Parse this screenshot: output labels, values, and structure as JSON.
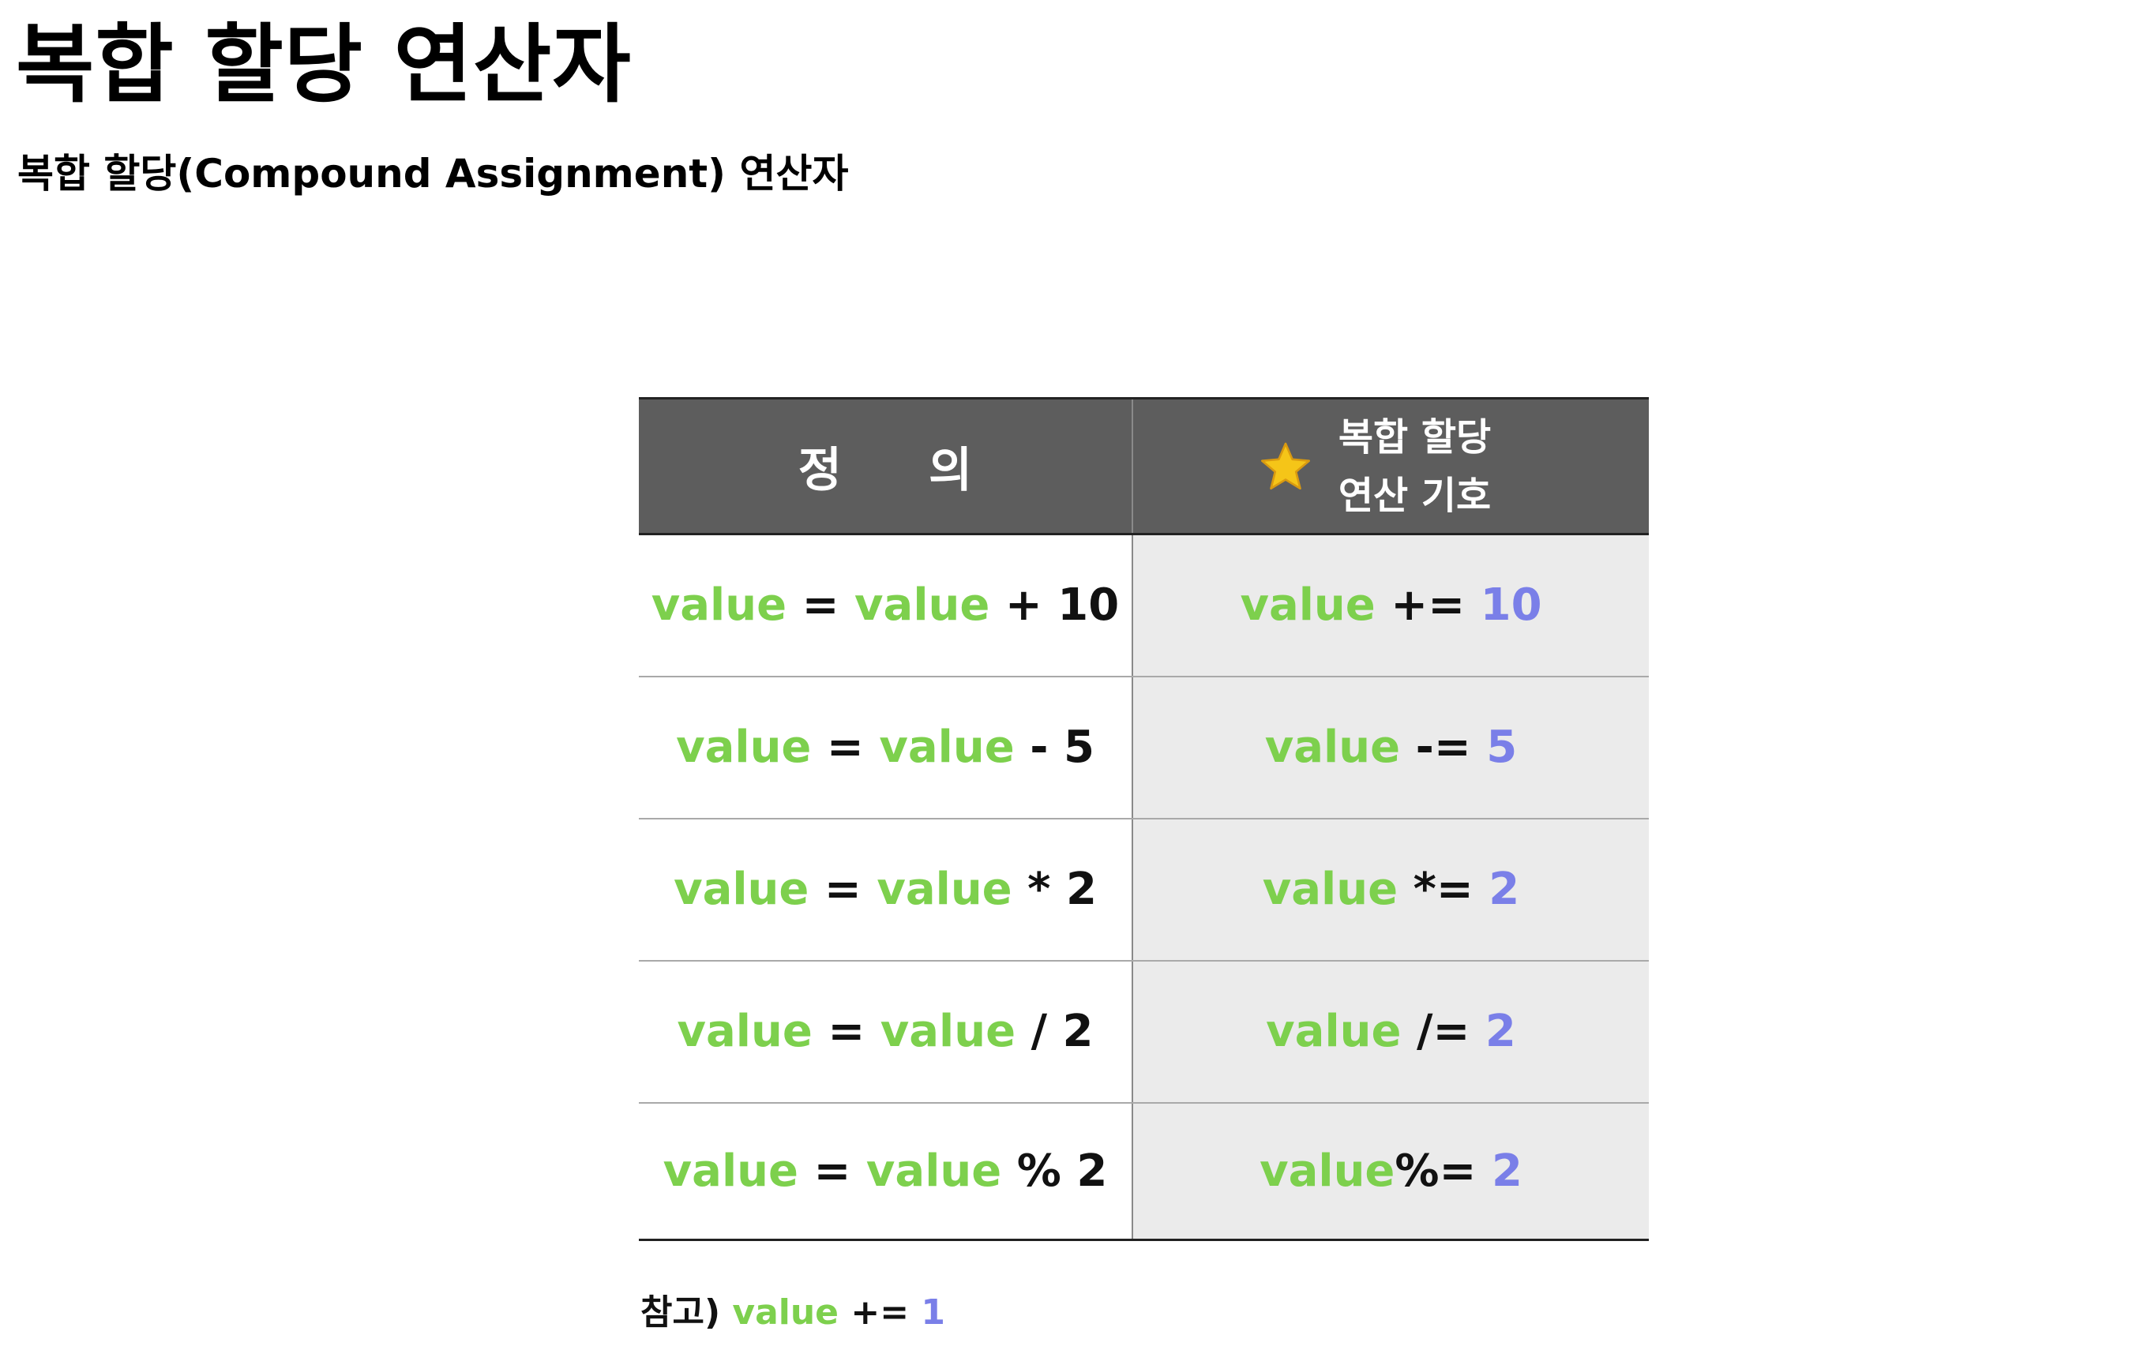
{
  "page": {
    "title": "복합 할당 연산자",
    "subtitle": "복합 할당(Compound Assignment) 연산자"
  },
  "table": {
    "header": {
      "definition_chars": [
        "정",
        "의"
      ],
      "symbol_icon": "star-icon",
      "symbol_lines": [
        "복합 할당",
        "연산 기호"
      ]
    },
    "rows": [
      {
        "def": {
          "var1": "value",
          "eq": "=",
          "var2": "value",
          "op": "+",
          "num": "10"
        },
        "cmp": {
          "var": "value",
          "op": "+=",
          "num": "10"
        }
      },
      {
        "def": {
          "var1": "value",
          "eq": "=",
          "var2": "value",
          "op": "-",
          "num": "5"
        },
        "cmp": {
          "var": "value",
          "op": "-=",
          "num": "5"
        }
      },
      {
        "def": {
          "var1": "value",
          "eq": "=",
          "var2": "value",
          "op": "*",
          "num": "2"
        },
        "cmp": {
          "var": "value",
          "op": "*=",
          "num": "2"
        }
      },
      {
        "def": {
          "var1": "value",
          "eq": "=",
          "var2": "value",
          "op": "/",
          "num": "2"
        },
        "cmp": {
          "var": "value",
          "op": "/=",
          "num": "2"
        }
      },
      {
        "def": {
          "var1": "value",
          "eq": "=",
          "var2": "value",
          "op": "%",
          "num": "2"
        },
        "cmp": {
          "var": "value",
          "op": "%=",
          "num": "2"
        }
      }
    ]
  },
  "note": {
    "label": "참고)",
    "var": "value",
    "op": "+=",
    "num": "1"
  },
  "colors": {
    "header_bg": "#5d5d5d",
    "header_text": "#ffffff",
    "variable": "#7dd04d",
    "number_compound": "#7a7fe8",
    "operator": "#111111",
    "compound_cell_bg": "#ebebeb",
    "star": "#f5c518"
  }
}
